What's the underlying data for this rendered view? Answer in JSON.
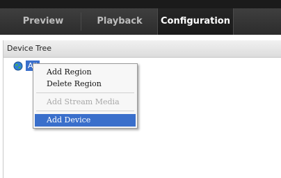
{
  "tabs": [
    {
      "label": "Preview",
      "active": false
    },
    {
      "label": "Playback",
      "active": false
    },
    {
      "label": "Configuration",
      "active": true
    }
  ],
  "device_tree": {
    "title": "Device Tree",
    "root_label": "All"
  },
  "context_menu": {
    "items": [
      {
        "label": "Add Region",
        "enabled": true
      },
      {
        "label": "Delete Region",
        "enabled": true
      },
      {
        "label": "Add Stream Media",
        "enabled": false
      },
      {
        "label": "Add Device",
        "enabled": true,
        "selected": true
      }
    ]
  },
  "colors": {
    "selection": "#3a6fcb",
    "tabbar": "#333333",
    "active_tab": "#1f1f1f"
  }
}
